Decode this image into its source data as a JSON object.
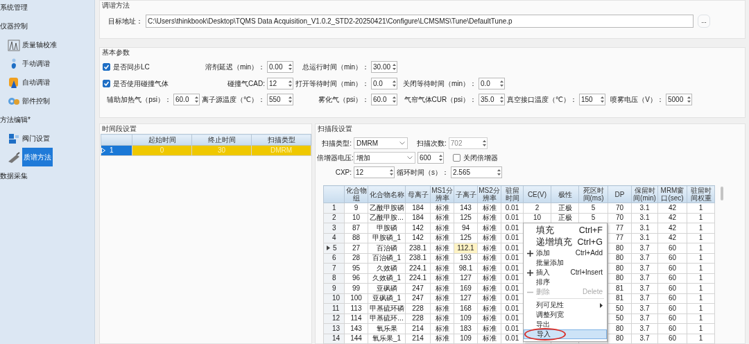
{
  "sidebar": {
    "groups": [
      {
        "label": "系统管理"
      },
      {
        "label": "仪器控制",
        "children": [
          {
            "label": "质量轴校准",
            "selected": false
          },
          {
            "label": "手动调谐",
            "selected": false
          },
          {
            "label": "自动调谐",
            "selected": false
          },
          {
            "label": "部件控制",
            "selected": false
          }
        ]
      },
      {
        "label": "方法编辑*",
        "children": [
          {
            "label": "阀门设置",
            "selected": false
          },
          {
            "label": "质谱方法",
            "selected": true
          }
        ]
      },
      {
        "label": "数据采集"
      }
    ]
  },
  "tune_method": {
    "title": "调谐方法",
    "target_label": "目标地址：",
    "path": "C:\\Users\\thinkbook\\Desktop\\TQMS Data Acquisition_V1.0.2_STD2-20250421\\Configure\\LCMSMS\\Tune\\DefaultTune.p",
    "browse": "..."
  },
  "basic_params": {
    "title": "基本参数",
    "rows": [
      [
        {
          "kind": "checkbox",
          "label": "是否同步LC",
          "checked": true
        },
        {
          "kind": "number",
          "label": "溶剂延迟（min）：",
          "value": "0.00"
        },
        {
          "kind": "number",
          "label": "总运行时间（min）：",
          "value": "30.00"
        }
      ],
      [
        {
          "kind": "checkbox",
          "label": "是否使用碰撞气体",
          "checked": true
        },
        {
          "kind": "number",
          "label": "碰撞气CAD:",
          "value": "12"
        },
        {
          "kind": "number",
          "label": "打开等待时间（min）：",
          "value": "0.0"
        },
        {
          "kind": "number",
          "label": "关闭等待时间（min）：",
          "value": "0.0"
        }
      ],
      [
        {
          "kind": "number",
          "label": "辅助加热气（psi）：",
          "value": "60.0"
        },
        {
          "kind": "number",
          "label": "离子源温度（℃）：",
          "value": "550"
        },
        {
          "kind": "number",
          "label": "雾化气（psi）：",
          "value": "60.0"
        },
        {
          "kind": "number",
          "label": "气帘气体CUR（psi）：",
          "value": "35.0"
        },
        {
          "kind": "number",
          "label": "真空接口温度（℃）：",
          "value": "150"
        },
        {
          "kind": "number",
          "label": "喷雾电压（V）：",
          "value": "5000"
        }
      ]
    ]
  },
  "time_segments": {
    "title": "时间段设置",
    "columns": [
      "起始时间",
      "终止时间",
      "扫描类型"
    ],
    "rows": [
      {
        "index": "1",
        "cells": [
          "0",
          "30",
          "DMRM"
        ],
        "selected": true
      }
    ]
  },
  "scan_segment": {
    "title": "扫描段设置",
    "scan_type": {
      "label": "扫描类型:",
      "value": "DMRM"
    },
    "scan_count": {
      "label": "扫描次数:",
      "value": "702",
      "disabled": true
    },
    "multiplier": {
      "label": "倍增器电压:",
      "value": "增加",
      "voltage": "600"
    },
    "close_multiplier": {
      "label": "关闭倍增器",
      "checked": false
    },
    "cxp": {
      "label": "CXP:",
      "value": "12"
    },
    "cycle_time": {
      "label": "循环时间（s）：",
      "value": "2.565"
    },
    "table": {
      "columns": [
        {
          "label": "化合物组",
          "focused": false
        },
        {
          "label": "化合物名称",
          "focused": false
        },
        {
          "label": "母离子",
          "focused": false
        },
        {
          "label": "MS1分辨率",
          "focused": false
        },
        {
          "label": "子离子",
          "focused": true
        },
        {
          "label": "MS2分辨率",
          "focused": false
        },
        {
          "label": "驻留时间",
          "focused": false
        },
        {
          "label": "CE(V)",
          "focused": false
        },
        {
          "label": "极性",
          "focused": false
        },
        {
          "label": "死区时间(ms)",
          "focused": false
        },
        {
          "label": "DP",
          "focused": false
        },
        {
          "label": "保留时间(min)",
          "focused": false
        },
        {
          "label": "MRM窗口(sec)",
          "focused": false
        },
        {
          "label": "驻留时间权重",
          "focused": false
        }
      ],
      "rows": [
        {
          "index": "1",
          "selected": false,
          "cells": [
            "9",
            "乙酰甲胺磷",
            "184",
            "标准",
            "143",
            "标准",
            "0.01",
            "2",
            "正极",
            "5",
            "70",
            "3.1",
            "42",
            "1"
          ]
        },
        {
          "index": "2",
          "selected": false,
          "cells": [
            "10",
            "乙酰甲胺...",
            "184",
            "标准",
            "125",
            "标准",
            "0.01",
            "10",
            "正极",
            "5",
            "70",
            "3.1",
            "42",
            "1"
          ]
        },
        {
          "index": "3",
          "selected": false,
          "cells": [
            "87",
            "甲胺磷",
            "142",
            "标准",
            "94",
            "标准",
            "0.01",
            null,
            null,
            null,
            "77",
            "3.1",
            "42",
            "1"
          ]
        },
        {
          "index": "4",
          "selected": false,
          "cells": [
            "88",
            "甲胺磷_1",
            "142",
            "标准",
            "125",
            "标准",
            "0.01",
            null,
            null,
            null,
            "77",
            "3.1",
            "42",
            "1"
          ]
        },
        {
          "index": "5",
          "selected": true,
          "cells": [
            "27",
            "百治磷",
            "238.1",
            "标准",
            "112.1",
            "标准",
            "0.01",
            null,
            null,
            null,
            "80",
            "3.7",
            "60",
            "1"
          ]
        },
        {
          "index": "6",
          "selected": false,
          "cells": [
            "28",
            "百治磷_1",
            "238.1",
            "标准",
            "193",
            "标准",
            "0.01",
            null,
            null,
            null,
            "80",
            "3.7",
            "60",
            "1"
          ]
        },
        {
          "index": "7",
          "selected": false,
          "cells": [
            "95",
            "久效磷",
            "224.1",
            "标准",
            "98.1",
            "标准",
            "0.01",
            null,
            null,
            null,
            "80",
            "3.7",
            "60",
            "1"
          ]
        },
        {
          "index": "8",
          "selected": false,
          "cells": [
            "96",
            "久效磷_1",
            "224.1",
            "标准",
            "127",
            "标准",
            "0.01",
            null,
            null,
            null,
            "80",
            "3.7",
            "60",
            "1"
          ]
        },
        {
          "index": "9",
          "selected": false,
          "cells": [
            "99",
            "亚砜磷",
            "247",
            "标准",
            "169",
            "标准",
            "0.01",
            null,
            null,
            null,
            "81",
            "3.7",
            "60",
            "1"
          ]
        },
        {
          "index": "10",
          "selected": false,
          "cells": [
            "100",
            "亚砜磷_1",
            "247",
            "标准",
            "127",
            "标准",
            "0.01",
            null,
            null,
            null,
            "81",
            "3.7",
            "60",
            "1"
          ]
        },
        {
          "index": "11",
          "selected": false,
          "cells": [
            "113",
            "甲基硫环磷",
            "228",
            "标准",
            "168",
            "标准",
            "0.01",
            null,
            null,
            null,
            "50",
            "3.7",
            "60",
            "1"
          ]
        },
        {
          "index": "12",
          "selected": false,
          "cells": [
            "114",
            "甲基硫环...",
            "228",
            "标准",
            "109",
            "标准",
            "0.01",
            null,
            null,
            null,
            "50",
            "3.7",
            "60",
            "1"
          ]
        },
        {
          "index": "13",
          "selected": false,
          "cells": [
            "143",
            "氧乐果",
            "214",
            "标准",
            "183",
            "标准",
            "0.01",
            null,
            null,
            null,
            "80",
            "3.7",
            "60",
            "1"
          ]
        },
        {
          "index": "14",
          "selected": false,
          "cells": [
            "144",
            "氧乐果_1",
            "214",
            "标准",
            "109",
            "标准",
            "0.01",
            null,
            null,
            null,
            "80",
            "3.7",
            "60",
            "1"
          ]
        }
      ]
    },
    "context_menu": {
      "items": [
        {
          "kind": "large",
          "label": "填充",
          "shortcut": "Ctrl+F",
          "disabled": false,
          "selected": false,
          "circled": false
        },
        {
          "kind": "large",
          "label": "递增填充",
          "shortcut": "Ctrl+G",
          "disabled": false,
          "selected": false,
          "circled": false
        },
        {
          "kind": "plus",
          "label": "添加",
          "shortcut": "Ctrl+Add",
          "disabled": false,
          "selected": false,
          "circled": false
        },
        {
          "kind": "plain",
          "label": "批量添加",
          "disabled": false,
          "selected": false,
          "circled": false
        },
        {
          "kind": "plus",
          "label": "插入",
          "shortcut": "Ctrl+Insert",
          "disabled": false,
          "selected": false,
          "circled": false
        },
        {
          "kind": "plain",
          "label": "排序",
          "disabled": false,
          "selected": false,
          "circled": false
        },
        {
          "kind": "minus",
          "label": "删除",
          "shortcut": "Delete",
          "disabled": true,
          "selected": false,
          "circled": false
        },
        {
          "kind": "separator"
        },
        {
          "kind": "submenu",
          "label": "列可见性",
          "disabled": false,
          "selected": false,
          "circled": false
        },
        {
          "kind": "plain",
          "label": "调整列宽",
          "disabled": false,
          "selected": false,
          "circled": false
        },
        {
          "kind": "plain",
          "label": "导出",
          "disabled": false,
          "selected": false,
          "circled": false
        },
        {
          "kind": "plain",
          "label": "导入",
          "disabled": false,
          "selected": true,
          "circled": true
        }
      ]
    }
  }
}
